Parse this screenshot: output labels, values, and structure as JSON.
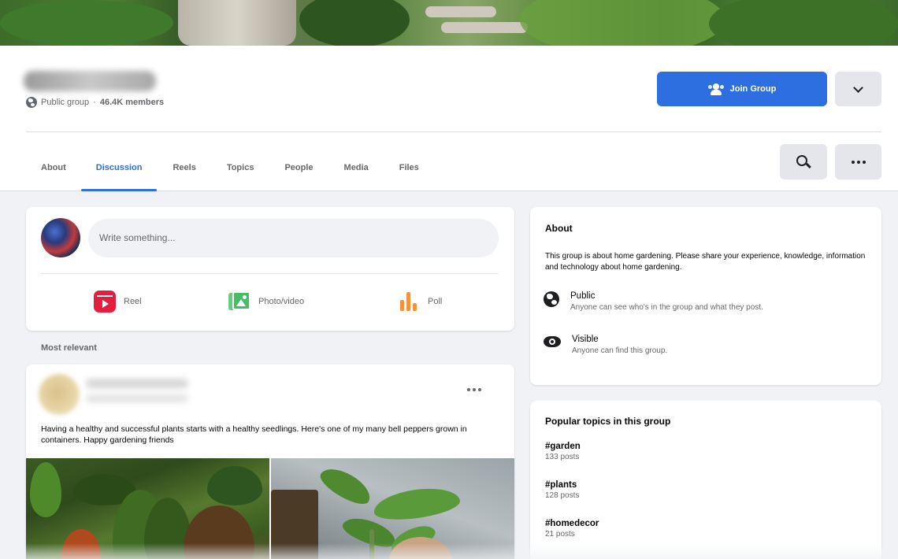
{
  "group": {
    "privacy": "Public group",
    "separator": "·",
    "members": "46.4K members"
  },
  "header": {
    "join_label": "Join Group"
  },
  "tabs": [
    {
      "label": "About"
    },
    {
      "label": "Discussion",
      "active": true
    },
    {
      "label": "Reels"
    },
    {
      "label": "Topics"
    },
    {
      "label": "People"
    },
    {
      "label": "Media"
    },
    {
      "label": "Files"
    }
  ],
  "composer": {
    "placeholder": "Write something...",
    "actions": [
      {
        "label": "Reel",
        "icon": "reel-icon"
      },
      {
        "label": "Photo/video",
        "icon": "photo-icon"
      },
      {
        "label": "Poll",
        "icon": "poll-icon"
      }
    ]
  },
  "feed": {
    "sort_label": "Most relevant"
  },
  "post": {
    "text": "Having a healthy and successful plants starts with a healthy seedlings. Here's one of my many bell peppers grown in containers. Happy gardening friends"
  },
  "about": {
    "title": "About",
    "description": "This group is about home gardening. Please share your experience, knowledge, information and technology about home gardening.",
    "rows": [
      {
        "title": "Public",
        "subtitle": "Anyone can see who's in the group and what they post.",
        "icon": "globe-icon"
      },
      {
        "title": "Visible",
        "subtitle": "Anyone can find this group.",
        "icon": "eye-icon"
      }
    ]
  },
  "topics": {
    "title": "Popular topics in this group",
    "items": [
      {
        "name": "#garden",
        "count": "133 posts"
      },
      {
        "name": "#plants",
        "count": "128 posts"
      },
      {
        "name": "#homedecor",
        "count": "21 posts"
      }
    ]
  },
  "colors": {
    "accent": "#2d6fe0",
    "reel": "#e41e3f",
    "photo": "#45bd62",
    "poll": "#f7923b"
  }
}
